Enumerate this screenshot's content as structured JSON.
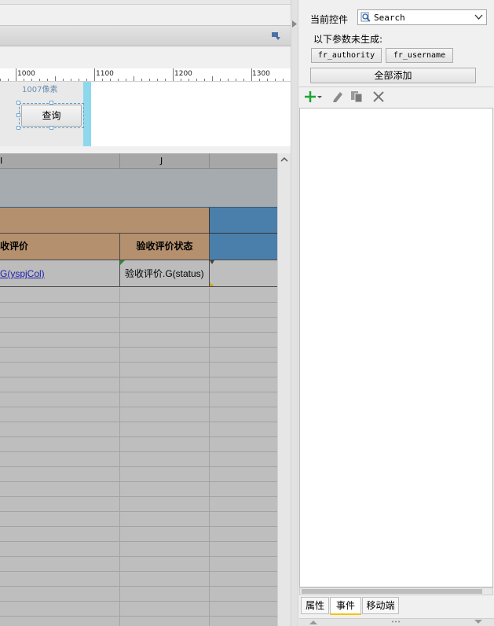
{
  "designer": {
    "ruler": {
      "labels": [
        "1000",
        "1100",
        "1200",
        "1300"
      ]
    },
    "widget_width_hint": "1007像素",
    "query_button_label": "查询"
  },
  "sheet": {
    "columns": [
      "I",
      "J"
    ],
    "header_cells": [
      "收评价",
      "验收评价状态"
    ],
    "data_cells": [
      "G(yspjCol)",
      "验收评价.G(status)"
    ]
  },
  "panel": {
    "current_control_label": "当前控件",
    "current_control_value": "Search",
    "ungenerated_label": "以下参数未生成:",
    "params": [
      "fr_authority",
      "fr_username"
    ],
    "add_all_label": "全部添加",
    "tabs": [
      "属性",
      "事件",
      "移动端"
    ],
    "active_tab": "事件"
  },
  "colors": {
    "header_brown": "#b4906e",
    "header_blue": "#4a7fab",
    "column_header_bg": "#a7a7a7",
    "link_blue": "#1f1fb0",
    "selection_cyan": "#8ed8ee"
  }
}
